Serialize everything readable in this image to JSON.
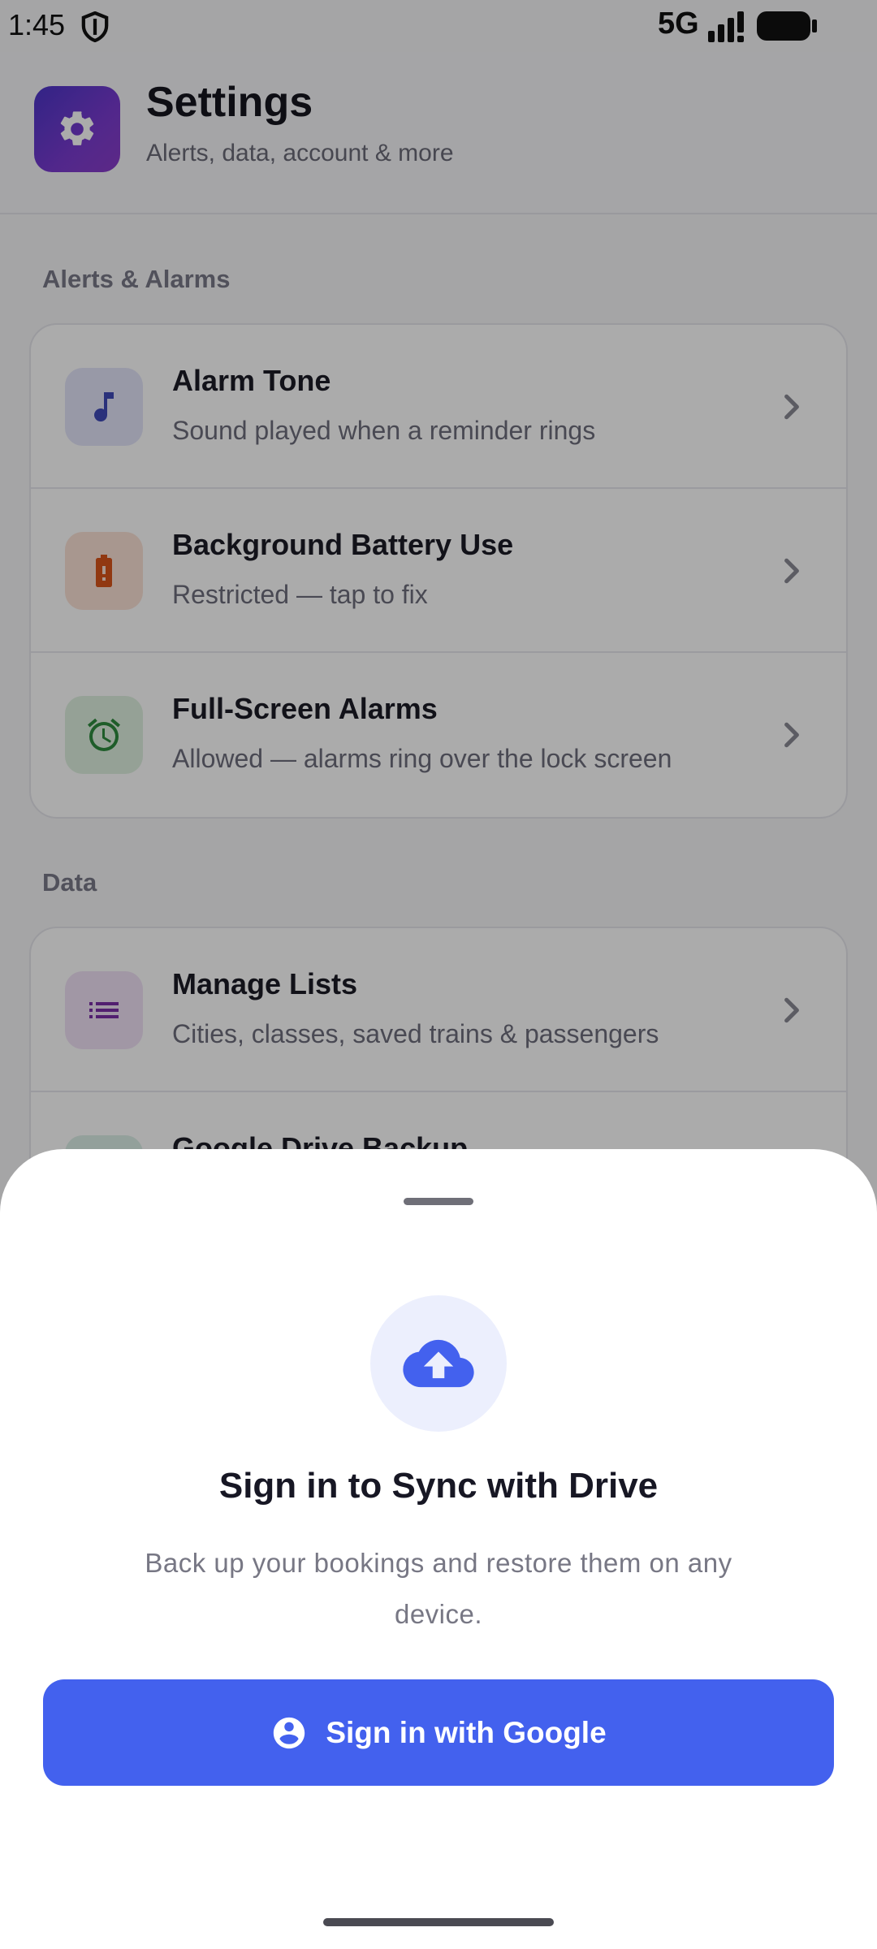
{
  "status": {
    "time": "1:45",
    "network": "5G",
    "icons": [
      "shield-icon",
      "signal-icon",
      "battery-icon"
    ]
  },
  "header": {
    "title": "Settings",
    "subtitle": "Alerts, data, account & more",
    "logo_icon": "gear-icon"
  },
  "sections": [
    {
      "label": "Alerts & Alarms",
      "items": [
        {
          "title": "Alarm Tone",
          "subtitle": "Sound played when a reminder rings",
          "icon": "music-note-icon",
          "accent": "#3f49b8"
        },
        {
          "title": "Background Battery Use",
          "subtitle": "Restricted — tap to fix",
          "icon": "battery-alert-icon",
          "accent": "#d9541a"
        },
        {
          "title": "Full-Screen Alarms",
          "subtitle": "Allowed — alarms ring over the lock screen",
          "icon": "alarm-clock-icon",
          "accent": "#2e8b3e"
        }
      ]
    },
    {
      "label": "Data",
      "items": [
        {
          "title": "Manage Lists",
          "subtitle": "Cities, classes, saved trains & passengers",
          "icon": "list-icon",
          "accent": "#7b2fa8"
        },
        {
          "title": "Google Drive Backup",
          "subtitle": "",
          "icon": "cloud-icon",
          "accent": "#2a8f6c"
        }
      ]
    }
  ],
  "sheet": {
    "icon": "cloud-upload-icon",
    "title": "Sign in to Sync with Drive",
    "description": "Back up your bookings and restore them on any device.",
    "button_label": "Sign in with Google",
    "button_icon": "account-circle-icon",
    "button_color": "#4361ee"
  }
}
